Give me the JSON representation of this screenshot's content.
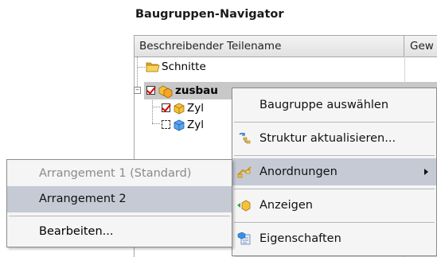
{
  "navigator": {
    "title": "Baugruppen-Navigator",
    "columns": [
      "Beschreibender Teilename",
      "Gew"
    ],
    "rows": [
      {
        "label": "Schnitte"
      },
      {
        "label": "zusbau"
      },
      {
        "label": "Zyl"
      },
      {
        "label": "Zyl"
      }
    ]
  },
  "context_menu": {
    "items": [
      {
        "label": "Baugruppe auswählen"
      },
      {
        "label": "Struktur aktualisieren..."
      },
      {
        "label": "Anordnungen"
      },
      {
        "label": "Anzeigen"
      },
      {
        "label": "Eigenschaften"
      }
    ]
  },
  "submenu": {
    "items": [
      {
        "label": "Arrangement 1 (Standard)",
        "state": "disabled"
      },
      {
        "label": "Arrangement 2",
        "state": "highlighted"
      },
      {
        "label": "Bearbeiten..."
      }
    ]
  },
  "colors": {
    "highlight": "#c5cad4",
    "check_red": "#dd0000",
    "folder_yellow": "#f3c23a",
    "part_blue": "#3a8ee6"
  }
}
